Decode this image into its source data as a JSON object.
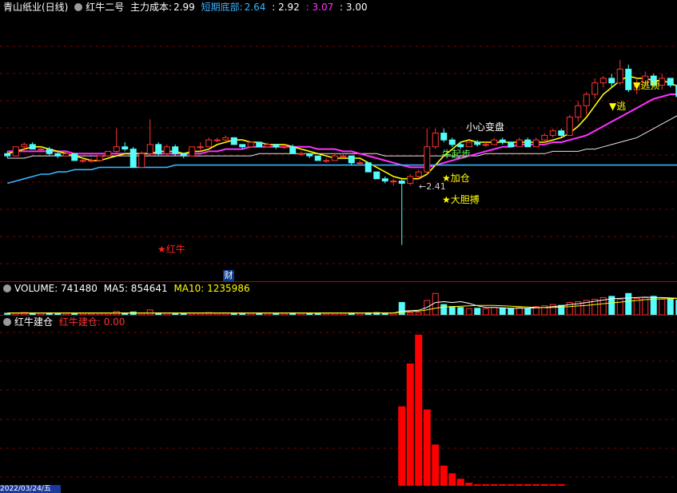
{
  "header": {
    "stock_name": "青山纸业(日线)",
    "indicator": "红牛二号",
    "main_cost_label": "主力成本:",
    "main_cost_value": "2.99",
    "short_bottom_label": "短期底部:",
    "short_bottom_value": "2.64",
    "val3": ": 2.92",
    "val4": ": 3.07",
    "val5": ": 3.00"
  },
  "annotations": {
    "careful_change": "小心变盘",
    "escape_top": "▼逃顶",
    "escape_top_2": "▼逃",
    "add_position": "★加仓",
    "bold_bet": "★大胆搏",
    "bull_start": "牛起步",
    "red_bull": "★红牛",
    "low_price": "←2.41",
    "finance_badge": "财"
  },
  "volume_header": {
    "label": "VOLUME: 741480",
    "ma5": "MA5: 854641",
    "ma10": "MA10: 1235986"
  },
  "build_header": {
    "label": "红牛建仓",
    "value": "红牛建仓: 0.00"
  },
  "date_label": "2022/03/24/五",
  "colors": {
    "up": "#ff3232",
    "down": "#54fcfc",
    "cost_line": "#3ab4ff",
    "ma_yellow": "#ffff00",
    "ma_magenta": "#ff30ff",
    "ma_white": "#e6e6e6",
    "grid": "#7f0000",
    "separator": "#c00000"
  },
  "chart_data": [
    {
      "type": "candlestick",
      "title": "青山纸业(日线)",
      "candles": [
        [
          2.81,
          2.82,
          2.79,
          2.8
        ],
        [
          2.8,
          2.84,
          2.8,
          2.84
        ],
        [
          2.84,
          2.86,
          2.82,
          2.85
        ],
        [
          2.85,
          2.86,
          2.83,
          2.83
        ],
        [
          2.83,
          2.84,
          2.82,
          2.83
        ],
        [
          2.83,
          2.84,
          2.8,
          2.81
        ],
        [
          2.81,
          2.82,
          2.79,
          2.8
        ],
        [
          2.8,
          2.82,
          2.8,
          2.81
        ],
        [
          2.81,
          2.81,
          2.78,
          2.78
        ],
        [
          2.78,
          2.79,
          2.77,
          2.78
        ],
        [
          2.78,
          2.79,
          2.77,
          2.78
        ],
        [
          2.78,
          2.8,
          2.78,
          2.8
        ],
        [
          2.8,
          2.82,
          2.8,
          2.82
        ],
        [
          2.82,
          2.92,
          2.81,
          2.84
        ],
        [
          2.84,
          2.86,
          2.82,
          2.83
        ],
        [
          2.83,
          2.84,
          2.75,
          2.75
        ],
        [
          2.75,
          2.82,
          2.75,
          2.81
        ],
        [
          2.81,
          2.96,
          2.8,
          2.85
        ],
        [
          2.85,
          2.86,
          2.8,
          2.81
        ],
        [
          2.81,
          2.85,
          2.8,
          2.84
        ],
        [
          2.84,
          2.85,
          2.8,
          2.81
        ],
        [
          2.81,
          2.81,
          2.79,
          2.8
        ],
        [
          2.8,
          2.84,
          2.8,
          2.84
        ],
        [
          2.84,
          2.86,
          2.82,
          2.84
        ],
        [
          2.84,
          2.88,
          2.84,
          2.87
        ],
        [
          2.87,
          2.88,
          2.86,
          2.87
        ],
        [
          2.87,
          2.89,
          2.86,
          2.88
        ],
        [
          2.88,
          2.88,
          2.85,
          2.85
        ],
        [
          2.85,
          2.85,
          2.83,
          2.84
        ],
        [
          2.84,
          2.86,
          2.84,
          2.86
        ],
        [
          2.86,
          2.86,
          2.84,
          2.84
        ],
        [
          2.84,
          2.86,
          2.84,
          2.85
        ],
        [
          2.85,
          2.85,
          2.83,
          2.84
        ],
        [
          2.84,
          2.85,
          2.83,
          2.84
        ],
        [
          2.84,
          2.85,
          2.81,
          2.81
        ],
        [
          2.81,
          2.82,
          2.8,
          2.81
        ],
        [
          2.81,
          2.81,
          2.79,
          2.8
        ],
        [
          2.8,
          2.8,
          2.78,
          2.78
        ],
        [
          2.78,
          2.79,
          2.77,
          2.78
        ],
        [
          2.78,
          2.81,
          2.78,
          2.8
        ],
        [
          2.8,
          2.81,
          2.79,
          2.8
        ],
        [
          2.8,
          2.8,
          2.76,
          2.77
        ],
        [
          2.77,
          2.78,
          2.76,
          2.77
        ],
        [
          2.77,
          2.77,
          2.73,
          2.73
        ],
        [
          2.73,
          2.73,
          2.7,
          2.7
        ],
        [
          2.7,
          2.71,
          2.68,
          2.69
        ],
        [
          2.69,
          2.7,
          2.67,
          2.69
        ],
        [
          2.69,
          2.7,
          2.41,
          2.68
        ],
        [
          2.68,
          2.72,
          2.67,
          2.71
        ],
        [
          2.71,
          2.74,
          2.7,
          2.73
        ],
        [
          2.73,
          2.92,
          2.72,
          2.84
        ],
        [
          2.84,
          2.92,
          2.83,
          2.9
        ],
        [
          2.9,
          2.92,
          2.86,
          2.87
        ],
        [
          2.87,
          2.88,
          2.84,
          2.85
        ],
        [
          2.85,
          2.86,
          2.83,
          2.84
        ],
        [
          2.84,
          2.86,
          2.84,
          2.86
        ],
        [
          2.86,
          2.87,
          2.84,
          2.85
        ],
        [
          2.85,
          2.86,
          2.84,
          2.85
        ],
        [
          2.85,
          2.88,
          2.85,
          2.87
        ],
        [
          2.87,
          2.88,
          2.85,
          2.86
        ],
        [
          2.86,
          2.86,
          2.84,
          2.84
        ],
        [
          2.84,
          2.88,
          2.84,
          2.87
        ],
        [
          2.87,
          2.88,
          2.84,
          2.84
        ],
        [
          2.84,
          2.88,
          2.84,
          2.87
        ],
        [
          2.87,
          2.9,
          2.86,
          2.89
        ],
        [
          2.89,
          2.92,
          2.88,
          2.91
        ],
        [
          2.91,
          2.92,
          2.88,
          2.89
        ],
        [
          2.89,
          2.98,
          2.89,
          2.97
        ],
        [
          2.97,
          3.04,
          2.95,
          3.02
        ],
        [
          3.02,
          3.08,
          2.98,
          3.07
        ],
        [
          3.07,
          3.14,
          3.05,
          3.12
        ],
        [
          3.12,
          3.15,
          3.1,
          3.14
        ],
        [
          3.14,
          3.16,
          3.1,
          3.12
        ],
        [
          3.12,
          3.22,
          3.11,
          3.18
        ],
        [
          3.18,
          3.2,
          3.08,
          3.09
        ],
        [
          3.09,
          3.14,
          3.07,
          3.12
        ],
        [
          3.12,
          3.17,
          3.11,
          3.15
        ],
        [
          3.15,
          3.16,
          3.1,
          3.11
        ],
        [
          3.11,
          3.16,
          3.09,
          3.14
        ],
        [
          3.14,
          3.14,
          3.1,
          3.11
        ],
        [
          3.11,
          3.11,
          3.06,
          3.06
        ]
      ],
      "ma_yellow": [
        2.81,
        2.82,
        2.83,
        2.84,
        2.84,
        2.83,
        2.82,
        2.81,
        2.8,
        2.79,
        2.78,
        2.78,
        2.79,
        2.8,
        2.81,
        2.81,
        2.81,
        2.81,
        2.82,
        2.82,
        2.82,
        2.81,
        2.82,
        2.82,
        2.83,
        2.85,
        2.86,
        2.87,
        2.87,
        2.86,
        2.86,
        2.85,
        2.85,
        2.85,
        2.84,
        2.83,
        2.82,
        2.81,
        2.8,
        2.79,
        2.79,
        2.79,
        2.79,
        2.77,
        2.75,
        2.73,
        2.71,
        2.7,
        2.7,
        2.7,
        2.72,
        2.76,
        2.8,
        2.83,
        2.86,
        2.87,
        2.86,
        2.86,
        2.86,
        2.86,
        2.86,
        2.86,
        2.86,
        2.86,
        2.86,
        2.87,
        2.88,
        2.9,
        2.93,
        2.97,
        3.02,
        3.07,
        3.1,
        3.13,
        3.15,
        3.14,
        3.14,
        3.13,
        3.13,
        3.12,
        3.1
      ],
      "ma_magenta": [
        2.82,
        2.82,
        2.82,
        2.82,
        2.82,
        2.82,
        2.82,
        2.82,
        2.81,
        2.81,
        2.81,
        2.81,
        2.81,
        2.81,
        2.81,
        2.81,
        2.81,
        2.81,
        2.81,
        2.81,
        2.81,
        2.81,
        2.81,
        2.81,
        2.82,
        2.82,
        2.83,
        2.83,
        2.83,
        2.84,
        2.84,
        2.84,
        2.84,
        2.84,
        2.84,
        2.84,
        2.84,
        2.83,
        2.83,
        2.83,
        2.82,
        2.82,
        2.81,
        2.8,
        2.79,
        2.78,
        2.77,
        2.76,
        2.75,
        2.75,
        2.75,
        2.76,
        2.77,
        2.78,
        2.79,
        2.8,
        2.81,
        2.82,
        2.83,
        2.84,
        2.84,
        2.85,
        2.85,
        2.85,
        2.85,
        2.86,
        2.86,
        2.87,
        2.88,
        2.89,
        2.91,
        2.93,
        2.95,
        2.97,
        2.99,
        3.01,
        3.03,
        3.05,
        3.06,
        3.07,
        3.07
      ],
      "ma_white": [
        2.79,
        2.79,
        2.79,
        2.8,
        2.8,
        2.8,
        2.8,
        2.8,
        2.8,
        2.8,
        2.8,
        2.8,
        2.8,
        2.8,
        2.8,
        2.8,
        2.8,
        2.8,
        2.8,
        2.8,
        2.8,
        2.8,
        2.8,
        2.8,
        2.8,
        2.8,
        2.8,
        2.8,
        2.8,
        2.8,
        2.81,
        2.81,
        2.81,
        2.81,
        2.81,
        2.81,
        2.81,
        2.81,
        2.81,
        2.81,
        2.81,
        2.81,
        2.81,
        2.81,
        2.81,
        2.8,
        2.8,
        2.8,
        2.8,
        2.8,
        2.8,
        2.8,
        2.8,
        2.8,
        2.8,
        2.8,
        2.8,
        2.81,
        2.81,
        2.81,
        2.81,
        2.81,
        2.81,
        2.81,
        2.81,
        2.82,
        2.82,
        2.82,
        2.82,
        2.83,
        2.83,
        2.84,
        2.85,
        2.86,
        2.87,
        2.88,
        2.9,
        2.92,
        2.94,
        2.96,
        2.98
      ],
      "cost_line": [
        2.68,
        2.69,
        2.7,
        2.71,
        2.72,
        2.72,
        2.73,
        2.73,
        2.74,
        2.74,
        2.74,
        2.75,
        2.75,
        2.75,
        2.75,
        2.75,
        2.75,
        2.75,
        2.75,
        2.75,
        2.76,
        2.76,
        2.76,
        2.76,
        2.76,
        2.76,
        2.76,
        2.76,
        2.76,
        2.76,
        2.76,
        2.76,
        2.76,
        2.76,
        2.76,
        2.76,
        2.76,
        2.76,
        2.76,
        2.76,
        2.76,
        2.76,
        2.76,
        2.76,
        2.76,
        2.76,
        2.76,
        2.76,
        2.76,
        2.76,
        2.76,
        2.76,
        2.76,
        2.76,
        2.76,
        2.76,
        2.76,
        2.76,
        2.76,
        2.76,
        2.76,
        2.76,
        2.76,
        2.76,
        2.76,
        2.76,
        2.76,
        2.76,
        2.76,
        2.76,
        2.76,
        2.76,
        2.76,
        2.76,
        2.76,
        2.76,
        2.76,
        2.76,
        2.76,
        2.76,
        2.76
      ]
    },
    {
      "type": "bar",
      "title": "VOLUME",
      "values": [
        40,
        45,
        55,
        40,
        40,
        45,
        40,
        38,
        40,
        38,
        35,
        40,
        40,
        80,
        45,
        70,
        40,
        120,
        45,
        40,
        40,
        35,
        40,
        45,
        55,
        40,
        45,
        40,
        35,
        40,
        40,
        40,
        35,
        40,
        45,
        38,
        40,
        40,
        35,
        40,
        40,
        45,
        40,
        50,
        55,
        45,
        40,
        300,
        50,
        55,
        350,
        520,
        250,
        200,
        180,
        150,
        160,
        150,
        180,
        160,
        150,
        180,
        150,
        200,
        220,
        250,
        230,
        300,
        320,
        350,
        380,
        420,
        450,
        380,
        520,
        400,
        420,
        450,
        380,
        400,
        360
      ],
      "ma5": [
        45,
        45,
        45,
        45,
        45,
        45,
        45,
        45,
        45,
        45,
        45,
        45,
        45,
        45,
        45,
        45,
        45,
        45,
        45,
        45,
        45,
        45,
        45,
        45,
        45,
        45,
        45,
        45,
        45,
        45,
        45,
        45,
        45,
        45,
        45,
        45,
        45,
        45,
        45,
        45,
        45,
        45,
        45,
        45,
        45,
        45,
        45,
        90,
        100,
        110,
        180,
        300,
        320,
        300,
        320,
        280,
        220,
        180,
        180,
        170,
        160,
        160,
        160,
        170,
        180,
        200,
        220,
        250,
        270,
        300,
        330,
        360,
        390,
        400,
        410,
        420,
        430,
        420,
        420,
        410,
        400
      ],
      "ma10": [
        45,
        45,
        45,
        45,
        45,
        45,
        45,
        45,
        45,
        45,
        45,
        45,
        45,
        45,
        45,
        45,
        45,
        45,
        45,
        45,
        45,
        45,
        45,
        45,
        45,
        45,
        45,
        45,
        45,
        45,
        45,
        45,
        45,
        45,
        45,
        45,
        45,
        45,
        45,
        45,
        45,
        45,
        45,
        45,
        45,
        45,
        45,
        70,
        80,
        90,
        120,
        160,
        190,
        200,
        210,
        220,
        230,
        230,
        230,
        220,
        210,
        200,
        190,
        180,
        175,
        180,
        190,
        200,
        215,
        230,
        250,
        270,
        290,
        310,
        330,
        350,
        370,
        380,
        390,
        395,
        400
      ]
    },
    {
      "type": "bar",
      "title": "红牛建仓",
      "values": [
        0,
        0,
        0,
        0,
        0,
        0,
        0,
        0,
        0,
        0,
        0,
        0,
        0,
        0,
        0,
        0,
        0,
        0,
        0,
        0,
        0,
        0,
        0,
        0,
        0,
        0,
        0,
        0,
        0,
        0,
        0,
        0,
        0,
        0,
        0,
        0,
        0,
        0,
        0,
        0,
        0,
        0,
        0,
        0,
        0,
        0,
        0,
        102,
        157,
        194,
        98,
        53,
        26,
        16,
        9,
        4,
        2,
        2,
        2,
        2,
        2,
        2,
        2,
        2,
        2,
        2,
        2,
        0,
        0,
        0,
        0,
        0,
        0,
        0,
        0,
        0,
        0,
        0,
        0,
        0,
        0
      ],
      "ylim": [
        0,
        200
      ]
    }
  ]
}
